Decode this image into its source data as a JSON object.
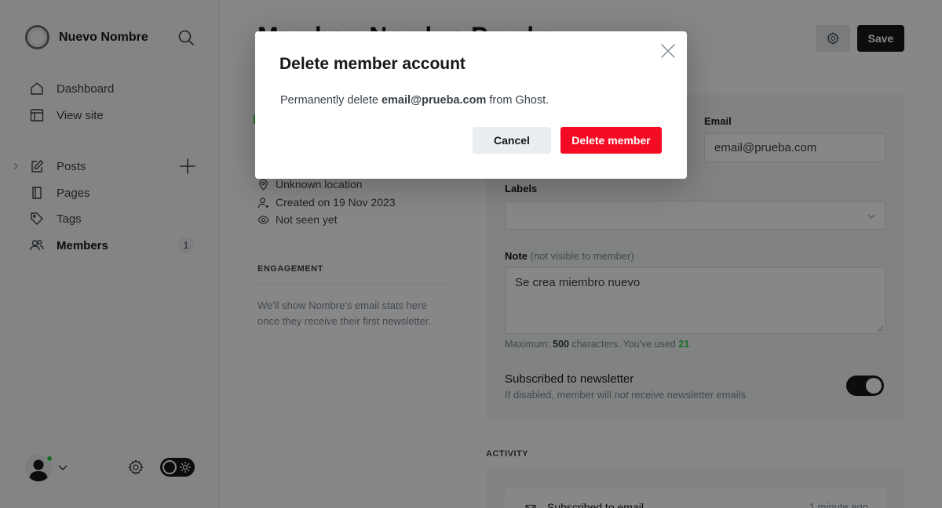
{
  "site": {
    "name": "Nuevo Nombre"
  },
  "sidebar": {
    "items": [
      {
        "label": "Dashboard",
        "icon": "home-icon"
      },
      {
        "label": "View site",
        "icon": "layout-icon"
      },
      {
        "label": "Posts",
        "icon": "pen-square-icon"
      },
      {
        "label": "Pages",
        "icon": "page-icon"
      },
      {
        "label": "Tags",
        "icon": "tag-icon"
      },
      {
        "label": "Members",
        "icon": "members-icon",
        "count": "1",
        "active": true
      }
    ]
  },
  "header": {
    "title": "Member: Nombre Prueba",
    "save_label": "Save"
  },
  "member": {
    "location": "Unknown location",
    "created": "Created on 19 Nov 2023",
    "last_seen": "Not seen yet"
  },
  "engagement": {
    "heading": "ENGAGEMENT",
    "text": "We'll show Nombre's email stats here once they receive their first newsletter."
  },
  "form": {
    "email_label": "Email",
    "email_value": "email@prueba.com",
    "labels_label": "Labels",
    "note_label": "Note",
    "note_hint": "(not visible to member)",
    "note_value": "Se crea miembro nuevo",
    "char_prefix": "Maximum: ",
    "char_max": "500",
    "char_mid": " characters. You've used ",
    "char_used": "21",
    "newsletter_title": "Subscribed to newsletter",
    "newsletter_desc_a": "If disabled, member will ",
    "newsletter_desc_em": "not",
    "newsletter_desc_b": " receive newsletter emails",
    "newsletter_enabled": true
  },
  "activity": {
    "heading": "ACTIVITY",
    "first_item": "Subscribed to email",
    "first_time": "1 minute ago"
  },
  "modal": {
    "title": "Delete member account",
    "body_prefix": "Permanently delete ",
    "body_email": "email@prueba.com",
    "body_suffix": " from Ghost.",
    "cancel_label": "Cancel",
    "delete_label": "Delete member"
  },
  "colors": {
    "accent_green": "#30cf43",
    "danger_red": "#f50b23",
    "dark": "#15171a"
  }
}
